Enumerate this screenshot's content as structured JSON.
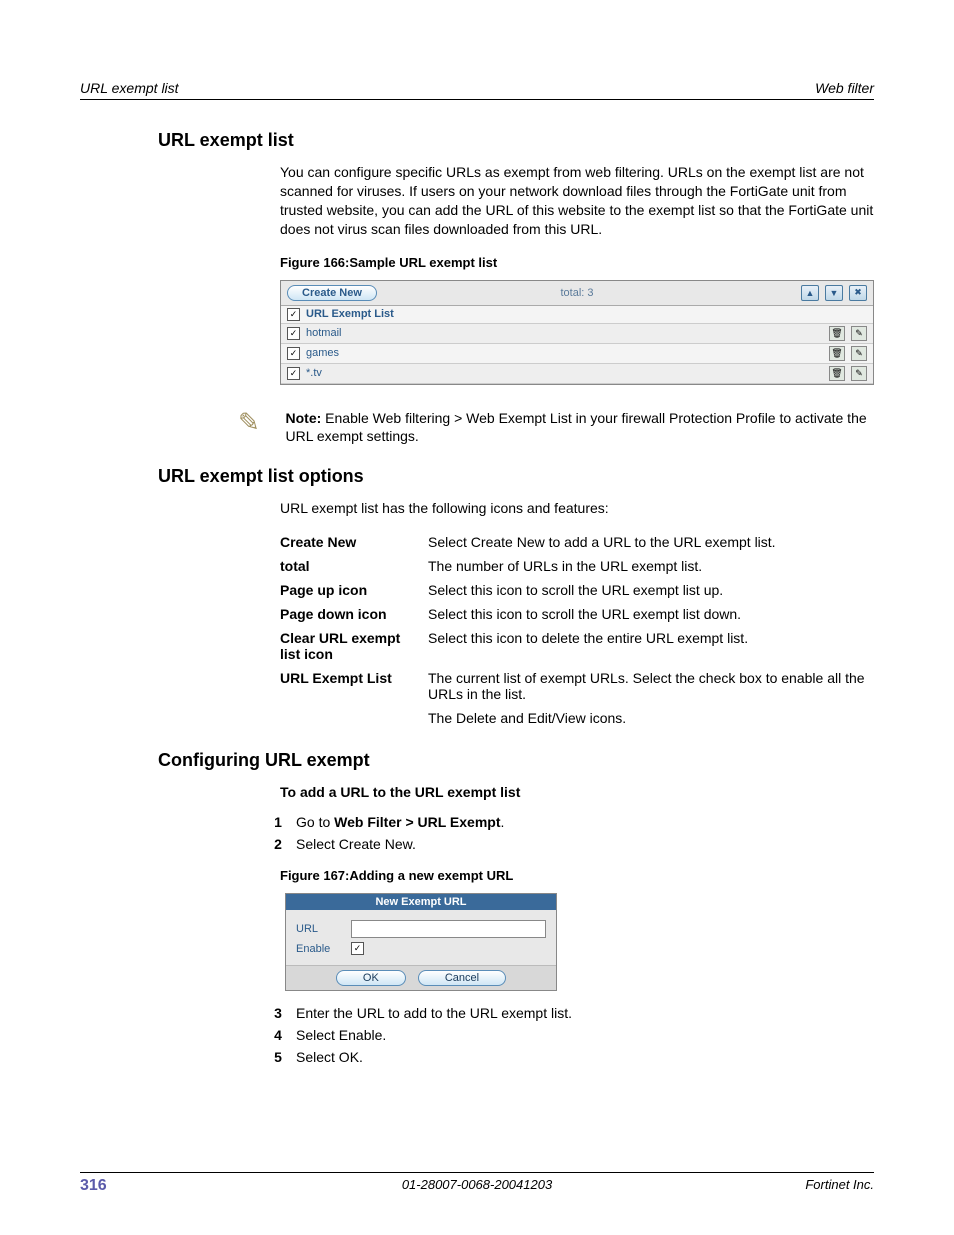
{
  "header": {
    "left": "URL exempt list",
    "right": "Web filter"
  },
  "h1": "URL exempt list",
  "intro": "You can configure specific URLs as exempt from web filtering. URLs on the exempt list are not scanned for viruses. If users on your network download files through the FortiGate unit from trusted website, you can add the URL of this website to the exempt list so that the FortiGate unit does not virus scan files downloaded from this URL.",
  "figure166_caption": "Figure 166:Sample URL exempt list",
  "fig166": {
    "create_new": "Create New",
    "total": "total: 3",
    "rows": [
      {
        "name": "URL Exempt List",
        "has_icons": false
      },
      {
        "name": "hotmail",
        "has_icons": true
      },
      {
        "name": "games",
        "has_icons": true
      },
      {
        "name": "*.tv",
        "has_icons": true
      }
    ]
  },
  "note_label": "Note:",
  "note_body": " Enable Web filtering > Web Exempt List in your firewall Protection Profile to activate the URL exempt settings.",
  "h2_options": "URL exempt list options",
  "options_intro": "URL exempt list has the following icons and features:",
  "options": [
    {
      "k": "Create New",
      "v": "Select Create New to add a URL to the URL exempt list."
    },
    {
      "k": "total",
      "v": "The number of URLs in the URL exempt list."
    },
    {
      "k": "Page up icon",
      "v": "Select this icon to scroll the URL exempt list up."
    },
    {
      "k": "Page down icon",
      "v": "Select this icon to scroll the URL exempt list down."
    },
    {
      "k": "Clear URL exempt list icon",
      "v": "Select this icon to delete the entire URL exempt list."
    },
    {
      "k": "URL Exempt List",
      "v": "The current list of exempt URLs. Select the check box to enable all the URLs in the list."
    },
    {
      "k": "",
      "v": "The Delete and Edit/View icons."
    }
  ],
  "h2_config": "Configuring URL exempt",
  "config_sub": "To add a URL to the URL exempt list",
  "step1_pre": "Go to ",
  "step1_bold": "Web Filter > URL Exempt",
  "step1_post": ".",
  "step2": "Select Create New.",
  "figure167_caption": "Figure 167:Adding a new exempt URL",
  "fig167": {
    "title": "New Exempt URL",
    "url_label": "URL",
    "enable_label": "Enable",
    "ok": "OK",
    "cancel": "Cancel"
  },
  "step3": "Enter the URL to add to the URL exempt list.",
  "step4": "Select Enable.",
  "step5": "Select OK.",
  "footer": {
    "page": "316",
    "center": "01-28007-0068-20041203",
    "right": "Fortinet Inc."
  },
  "nums": {
    "n1": "1",
    "n2": "2",
    "n3": "3",
    "n4": "4",
    "n5": "5"
  }
}
